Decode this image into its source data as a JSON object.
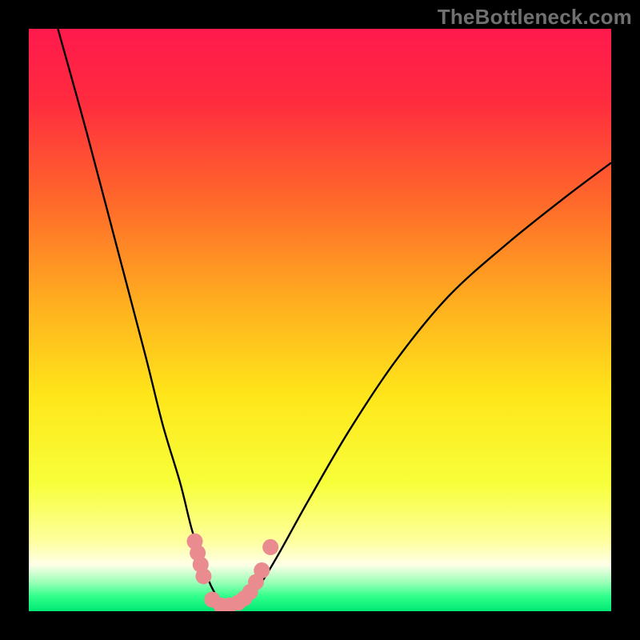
{
  "watermark": "TheBottleneck.com",
  "colors": {
    "frame": "#000000",
    "gradient_stops": [
      {
        "offset": 0.0,
        "color": "#ff1a4d"
      },
      {
        "offset": 0.12,
        "color": "#ff2a3f"
      },
      {
        "offset": 0.3,
        "color": "#ff6a2a"
      },
      {
        "offset": 0.48,
        "color": "#ffb21f"
      },
      {
        "offset": 0.63,
        "color": "#ffe61a"
      },
      {
        "offset": 0.78,
        "color": "#f7ff3a"
      },
      {
        "offset": 0.88,
        "color": "#feff9e"
      },
      {
        "offset": 0.92,
        "color": "#ffffe8"
      },
      {
        "offset": 0.95,
        "color": "#9dffb8"
      },
      {
        "offset": 0.975,
        "color": "#2fff8a"
      },
      {
        "offset": 1.0,
        "color": "#00e874"
      }
    ],
    "curve": "#000000",
    "markers": "#e98b8f"
  },
  "chart_data": {
    "type": "line",
    "title": "",
    "xlabel": "",
    "ylabel": "",
    "xlim": [
      0,
      100
    ],
    "ylim": [
      0,
      100
    ],
    "series": [
      {
        "name": "bottleneck-curve",
        "x": [
          5,
          10,
          15,
          20,
          23,
          26,
          28,
          30,
          31,
          32,
          33,
          34,
          35,
          36,
          38,
          40,
          43,
          48,
          55,
          63,
          72,
          82,
          92,
          100
        ],
        "y": [
          100,
          82,
          63,
          44,
          32,
          22,
          14,
          8,
          5,
          3,
          1.5,
          0.8,
          0.8,
          1.2,
          2.5,
          5,
          10,
          19,
          31,
          43,
          54,
          63,
          71,
          77
        ]
      }
    ],
    "markers": {
      "name": "highlight-points",
      "points": [
        {
          "x": 28.5,
          "y": 12
        },
        {
          "x": 29.0,
          "y": 10
        },
        {
          "x": 29.5,
          "y": 8
        },
        {
          "x": 30.0,
          "y": 6
        },
        {
          "x": 31.5,
          "y": 2
        },
        {
          "x": 33.0,
          "y": 1
        },
        {
          "x": 34.5,
          "y": 1
        },
        {
          "x": 36.0,
          "y": 1.5
        },
        {
          "x": 37.0,
          "y": 2.2
        },
        {
          "x": 38.0,
          "y": 3.3
        },
        {
          "x": 39.0,
          "y": 5
        },
        {
          "x": 40.0,
          "y": 7
        },
        {
          "x": 41.5,
          "y": 11
        }
      ]
    }
  }
}
